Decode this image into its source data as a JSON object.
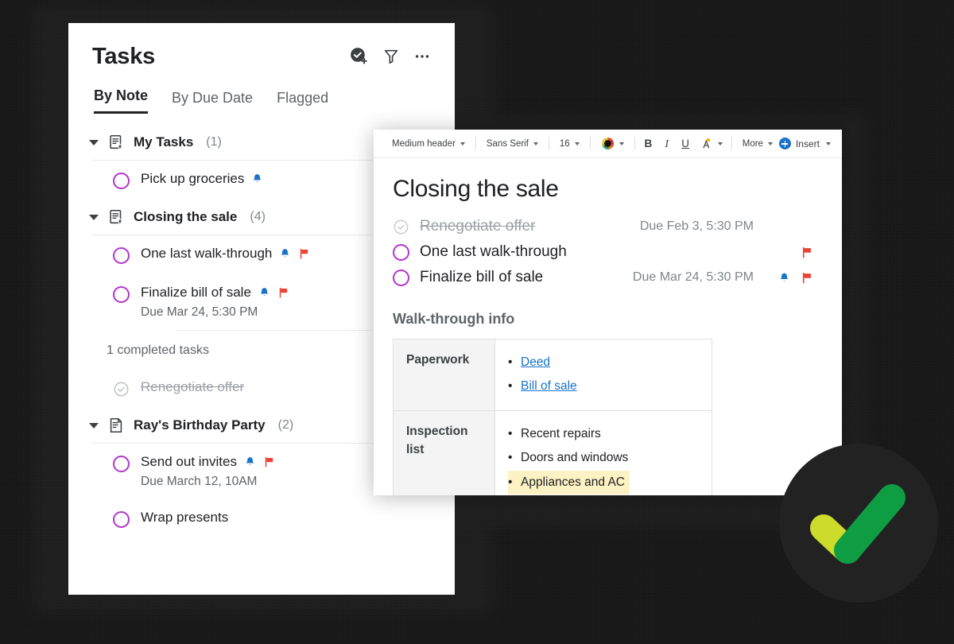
{
  "tasks_panel": {
    "title": "Tasks",
    "header_icons": [
      {
        "name": "add-task-icon",
        "label": "Add task"
      },
      {
        "name": "filter-icon",
        "label": "Filter"
      },
      {
        "name": "more-options-icon",
        "label": "More options"
      }
    ],
    "tabs": [
      {
        "label": "By Note",
        "active": true
      },
      {
        "label": "By Due Date",
        "active": false
      },
      {
        "label": "Flagged",
        "active": false
      }
    ],
    "groups": [
      {
        "name": "My Tasks",
        "count": "(1)",
        "icon": "note-starred-icon",
        "tasks": [
          {
            "text": "Pick up groceries",
            "due": "",
            "reminder": true,
            "flagged": false,
            "done": false
          }
        ]
      },
      {
        "name": "Closing the sale",
        "count": "(4)",
        "icon": "note-starred-icon",
        "tasks": [
          {
            "text": "One last walk-through",
            "due": "",
            "reminder": true,
            "flagged": true,
            "done": false
          },
          {
            "text": "Finalize bill of sale",
            "due": "Due Mar 24, 5:30 PM",
            "reminder": true,
            "flagged": true,
            "done": false
          }
        ],
        "completed_label": "1 completed tasks",
        "completed": [
          {
            "text": "Renegotiate offer",
            "due": "",
            "reminder": false,
            "flagged": false,
            "done": true
          }
        ]
      },
      {
        "name": "Ray's Birthday Party",
        "count": "(2)",
        "icon": "note-icon",
        "tasks": [
          {
            "text": "Send out invites",
            "due": "Due March 12, 10AM",
            "reminder": true,
            "flagged": true,
            "done": false
          },
          {
            "text": "Wrap presents",
            "due": "",
            "reminder": false,
            "flagged": false,
            "done": false
          }
        ]
      }
    ]
  },
  "note_panel": {
    "toolbar": {
      "style_select": "Medium header",
      "font_select": "Sans Serif",
      "size_select": "16",
      "bold_label": "B",
      "italic_label": "I",
      "underline_label": "U",
      "more_label": "More",
      "insert_label": "Insert"
    },
    "title": "Closing the sale",
    "tasks": [
      {
        "text": "Renegotiate offer",
        "due": "Due Feb 3, 5:30 PM",
        "reminder": false,
        "flagged": false,
        "done": true
      },
      {
        "text": "One last walk-through",
        "due": "",
        "reminder": false,
        "flagged": true,
        "done": false
      },
      {
        "text": "Finalize bill of sale",
        "due": "Due Mar 24, 5:30 PM",
        "reminder": true,
        "flagged": true,
        "done": false
      }
    ],
    "section_heading": "Walk-through info",
    "table": {
      "rows": [
        {
          "key": "Paperwork",
          "items": [
            {
              "text": "Deed",
              "link": true,
              "highlight": false
            },
            {
              "text": "Bill of sale",
              "link": true,
              "highlight": false
            }
          ]
        },
        {
          "key": "Inspection list",
          "items": [
            {
              "text": "Recent repairs",
              "link": false,
              "highlight": false
            },
            {
              "text": "Doors and windows",
              "link": false,
              "highlight": false
            },
            {
              "text": "Appliances and AC",
              "link": false,
              "highlight": true
            }
          ]
        }
      ]
    }
  },
  "badge": {
    "name": "green-check-badge",
    "circle_color": "#222222",
    "check_color_primary": "#0f9d44",
    "check_color_secondary": "#cddc2a"
  },
  "colors": {
    "checkbox_purple": "#b234cf",
    "reminder_blue": "#1a73c8",
    "flag_red": "#ea4335",
    "link_blue": "#1a73c8",
    "highlight_yellow": "#fdf2c3",
    "background_dark": "#191919"
  }
}
